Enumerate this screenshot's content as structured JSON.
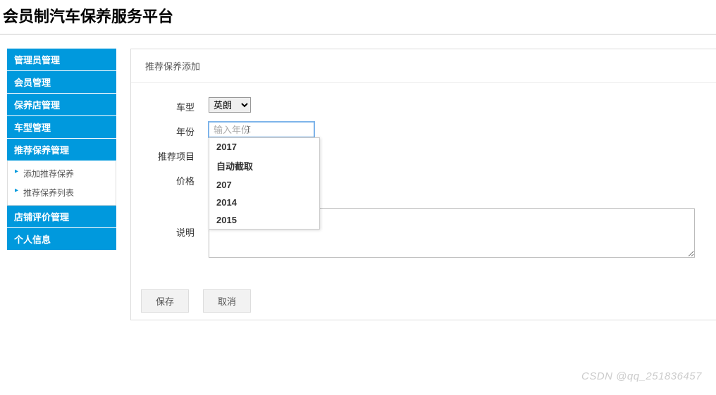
{
  "header": {
    "title": "会员制汽车保养服务平台"
  },
  "sidebar": {
    "nav1": "管理员管理",
    "nav2": "会员管理",
    "nav3": "保养店管理",
    "nav4": "车型管理",
    "nav5": "推荐保养管理",
    "nav5_sub": {
      "a": "添加推荐保养",
      "b": "推荐保养列表"
    },
    "nav6": "店铺评价管理",
    "nav7": "个人信息"
  },
  "panel": {
    "title": "推荐保养添加"
  },
  "form": {
    "model_label": "车型",
    "model_value": "英朗",
    "year_label": "年份",
    "year_placeholder": "输入年份",
    "year_value": "",
    "project_label": "推荐项目",
    "price_label": "价格",
    "desc_label": "说明",
    "desc_value": ""
  },
  "autocomplete": {
    "opt1": "2017",
    "opt2": "自动截取",
    "opt3": "207",
    "opt4": "2014",
    "opt5": "2015"
  },
  "buttons": {
    "save": "保存",
    "cancel": "取消"
  },
  "watermark": "CSDN @qq_251836457"
}
